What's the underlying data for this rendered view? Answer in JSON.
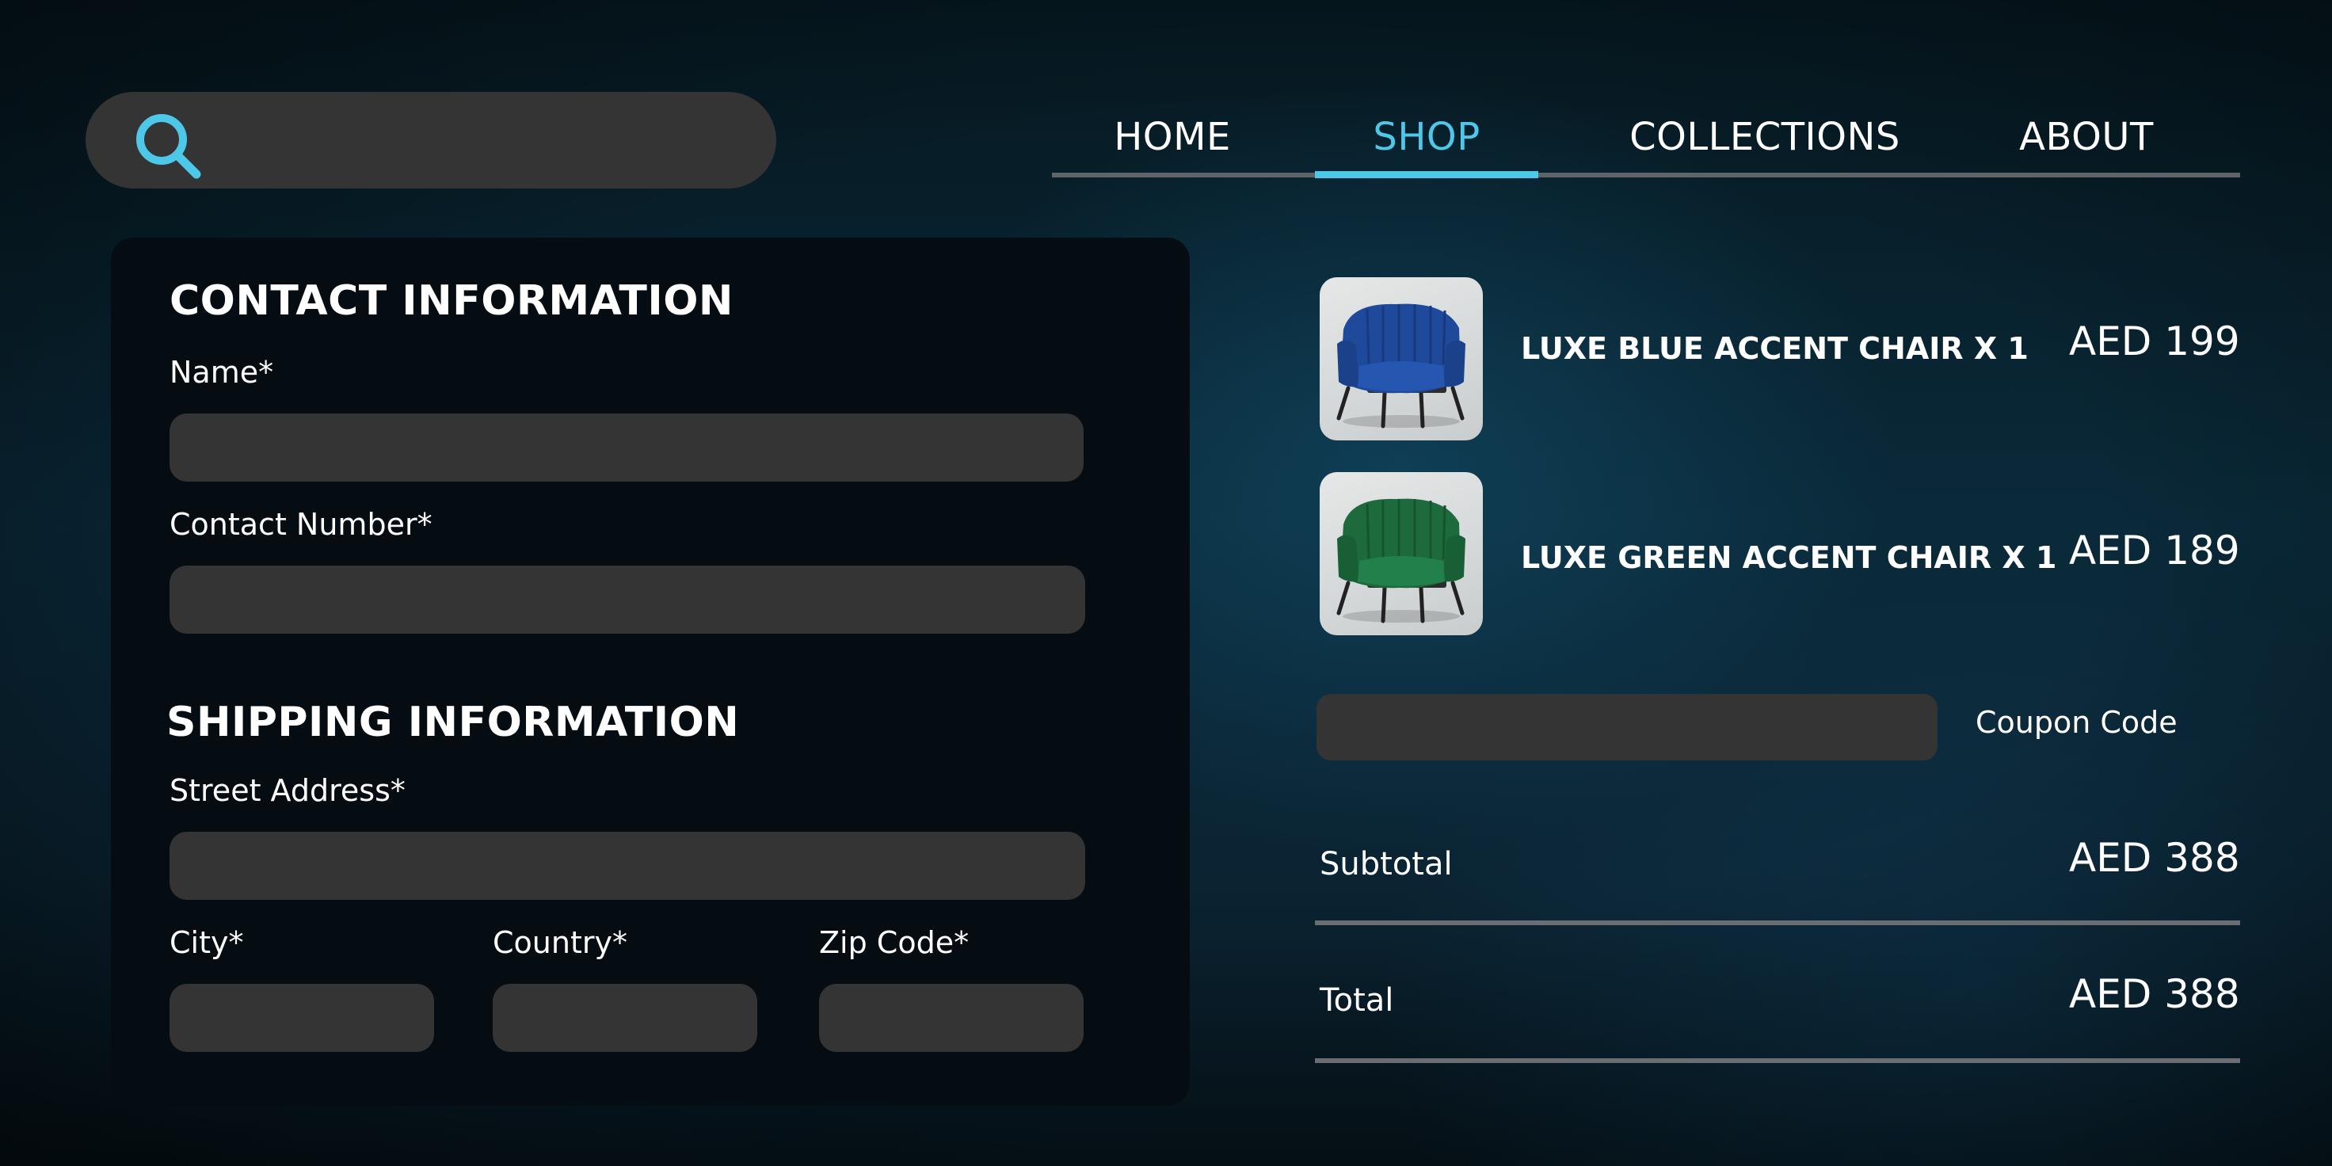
{
  "search": {
    "placeholder": "",
    "value": "",
    "icon": "search-icon",
    "accent_color": "#4dc8e8"
  },
  "nav": {
    "items": [
      {
        "label": "HOME",
        "active": false
      },
      {
        "label": "SHOP",
        "active": true
      },
      {
        "label": "COLLECTIONS",
        "active": false
      },
      {
        "label": "ABOUT",
        "active": false
      }
    ],
    "active_color": "#4dc8e8"
  },
  "form": {
    "contact": {
      "title": "CONTACT INFORMATION",
      "name_label": "Name*",
      "name_value": "",
      "phone_label": "Contact Number*",
      "phone_value": ""
    },
    "shipping": {
      "title": "SHIPPING INFORMATION",
      "street_label": "Street Address*",
      "street_value": "",
      "city_label": "City*",
      "city_value": "",
      "country_label": "Country*",
      "country_value": "",
      "zip_label": "Zip Code*",
      "zip_value": ""
    }
  },
  "cart": {
    "items": [
      {
        "name": "LUXE BLUE ACCENT CHAIR X 1",
        "price": "AED 199",
        "image": "blue-accent-chair",
        "color": "#1f4a9c"
      },
      {
        "name": "LUXE GREEN ACCENT CHAIR X 1",
        "price": "AED 189",
        "image": "green-accent-chair",
        "color": "#1d6b3c"
      }
    ],
    "coupon": {
      "label": "Coupon Code",
      "value": ""
    },
    "summary": {
      "subtotal_label": "Subtotal",
      "subtotal_value": "AED 388",
      "total_label": "Total",
      "total_value": "AED 388"
    }
  }
}
